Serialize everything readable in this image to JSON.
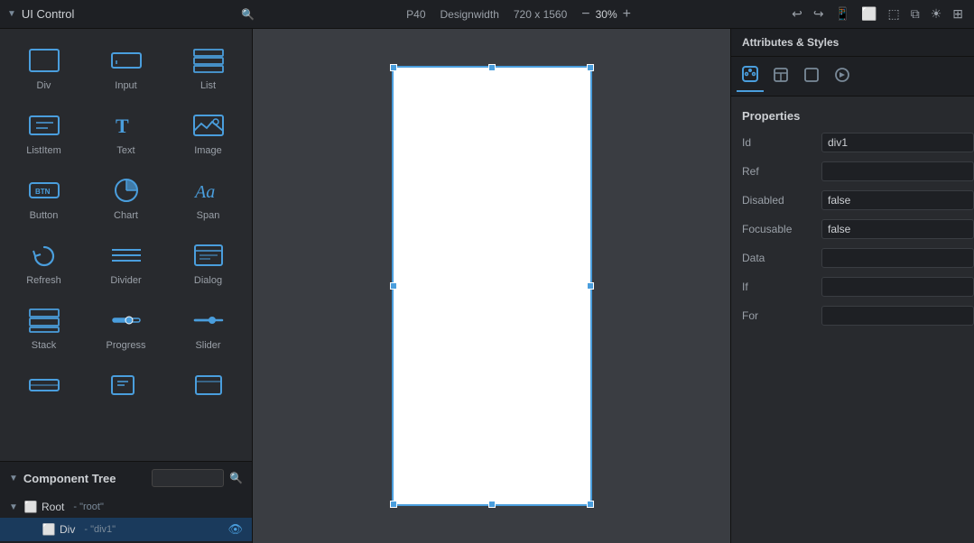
{
  "app": {
    "title": "UI Control"
  },
  "toolbar": {
    "device_name": "P40",
    "design_label": "Designwidth",
    "resolution": "720 x 1560",
    "zoom_percent": "30%",
    "undo_label": "Undo",
    "redo_label": "Redo",
    "phone_icon": "Phone",
    "tablet_icon": "Tablet",
    "rotate_icon": "Rotate",
    "layers_icon": "Layers",
    "sun_icon": "Sun",
    "grid_icon": "Grid"
  },
  "components": {
    "rows": [
      [
        {
          "id": "div",
          "label": "Div"
        },
        {
          "id": "input",
          "label": "Input"
        },
        {
          "id": "list",
          "label": "List"
        }
      ],
      [
        {
          "id": "listitem",
          "label": "ListItem"
        },
        {
          "id": "text",
          "label": "Text"
        },
        {
          "id": "image",
          "label": "Image"
        }
      ],
      [
        {
          "id": "button",
          "label": "Button"
        },
        {
          "id": "chart",
          "label": "Chart"
        },
        {
          "id": "span",
          "label": "Span"
        }
      ],
      [
        {
          "id": "refresh",
          "label": "Refresh"
        },
        {
          "id": "divider",
          "label": "Divider"
        },
        {
          "id": "dialog",
          "label": "Dialog"
        }
      ],
      [
        {
          "id": "stack",
          "label": "Stack"
        },
        {
          "id": "progress",
          "label": "Progress"
        },
        {
          "id": "slider",
          "label": "Slider"
        }
      ]
    ]
  },
  "component_tree": {
    "title": "Component Tree",
    "search_placeholder": "",
    "items": [
      {
        "id": "root-item",
        "indent": 0,
        "expanded": true,
        "icon": "□",
        "name": "Root",
        "id_label": "- \"root\"",
        "selected": false,
        "eye": false
      },
      {
        "id": "div-item",
        "indent": 1,
        "expanded": false,
        "icon": "□",
        "name": "Div",
        "id_label": "- \"div1\"",
        "selected": true,
        "eye": true
      }
    ]
  },
  "attributes": {
    "panel_title": "Attributes & Styles",
    "section_title": "Properties",
    "rows": [
      {
        "label": "Id",
        "value": "div1",
        "editable": true
      },
      {
        "label": "Ref",
        "value": "",
        "editable": true
      },
      {
        "label": "Disabled",
        "value": "false",
        "editable": true
      },
      {
        "label": "Focusable",
        "value": "false",
        "editable": true
      },
      {
        "label": "Data",
        "value": "",
        "editable": true
      },
      {
        "label": "If",
        "value": "",
        "editable": true
      },
      {
        "label": "For",
        "value": "",
        "editable": true
      }
    ]
  }
}
